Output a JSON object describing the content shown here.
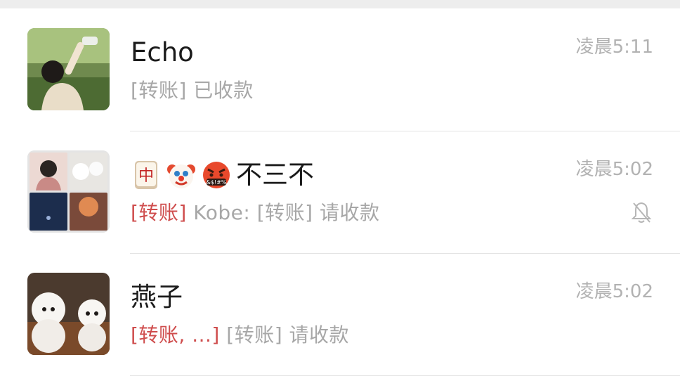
{
  "chats": [
    {
      "name": "Echo",
      "preview": "[转账] 已收款",
      "time": "凌晨5:11"
    },
    {
      "name_emojis": [
        "mahjong-red-dragon",
        "clown-face",
        "face-with-symbols-on-mouth"
      ],
      "name_text": "不三不",
      "preview_tag": "[转账]",
      "preview": "Kobe: [转账] 请收款",
      "time": "凌晨5:02",
      "muted_icon": "bell-slash-icon"
    },
    {
      "name": "燕子",
      "preview_tag": "[转账, ...]",
      "preview": "[转账] 请收款",
      "time": "凌晨5:02"
    }
  ],
  "colors": {
    "tag_red": "#cf4d4d",
    "preview_gray": "#a7a7a7",
    "time_gray": "#b2b2b2",
    "divider": "#e3e3e3"
  }
}
